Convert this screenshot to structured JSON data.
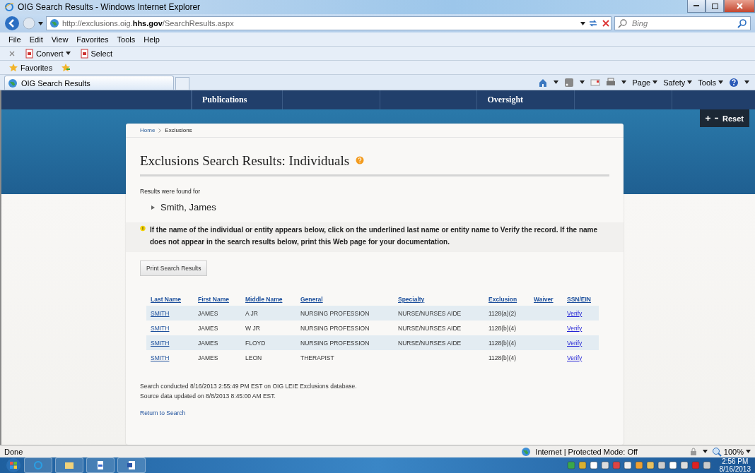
{
  "window": {
    "title": "OIG Search Results - Windows Internet Explorer"
  },
  "address_bar": {
    "url": "http://exclusions.oig.**hhs.gov**/SearchResults.aspx"
  },
  "search": {
    "placeholder": "Bing"
  },
  "menu": [
    "File",
    "Edit",
    "View",
    "Favorites",
    "Tools",
    "Help"
  ],
  "addon_bar": [
    {
      "label": "Convert",
      "has_menu": true
    },
    {
      "label": "Select",
      "has_menu": false
    }
  ],
  "favorites_bar": {
    "label": "Favorites"
  },
  "tabs": [
    {
      "label": "OIG Search Results",
      "selected": true
    }
  ],
  "command_bar": [
    "Page",
    "Safety",
    "Tools"
  ],
  "site_nav": [
    "Publications",
    "Oversight"
  ],
  "zoom_control": {
    "label": "Reset"
  },
  "breadcrumb": [
    "Home",
    "Exclusions"
  ],
  "heading": "Exclusions Search Results: Individuals",
  "results_label": "Results were found for",
  "query": "Smith, James",
  "notice": "If the name of the individual or entity appears below, click on the underlined last name or entity name to Verify the record. If the name does not appear in the search results below, print this Web page for your documentation.",
  "print_button": "Print Search Results",
  "table": {
    "columns": [
      "Last Name",
      "First Name",
      "Middle Name",
      "General",
      "Specialty",
      "Exclusion",
      "Waiver",
      "SSN/EIN"
    ],
    "rows": [
      [
        "SMITH",
        "JAMES",
        "A JR",
        "NURSING PROFESSION",
        "NURSE/NURSES AIDE",
        "1128(a)(2)",
        "",
        "Verify"
      ],
      [
        "SMITH",
        "JAMES",
        "W JR",
        "NURSING PROFESSION",
        "NURSE/NURSES AIDE",
        "1128(b)(4)",
        "",
        "Verify"
      ],
      [
        "SMITH",
        "JAMES",
        "FLOYD",
        "NURSING PROFESSION",
        "NURSE/NURSES AIDE",
        "1128(b)(4)",
        "",
        "Verify"
      ],
      [
        "SMITH",
        "JAMES",
        "LEON",
        "THERAPIST",
        "",
        "1128(b)(4)",
        "",
        "Verify"
      ]
    ]
  },
  "footnotes": [
    "Search conducted 8/16/2013 2:55:49 PM EST on OIG LEIE Exclusions database.",
    "Source data updated on 8/8/2013 8:45:00 AM EST."
  ],
  "return_link": "Return to Search",
  "status_bar": {
    "text": "Done",
    "zone": "Internet | Protected Mode: Off",
    "zoom": "100%"
  },
  "taskbar": {
    "time": "2:56 PM",
    "date": "8/16/2013"
  }
}
